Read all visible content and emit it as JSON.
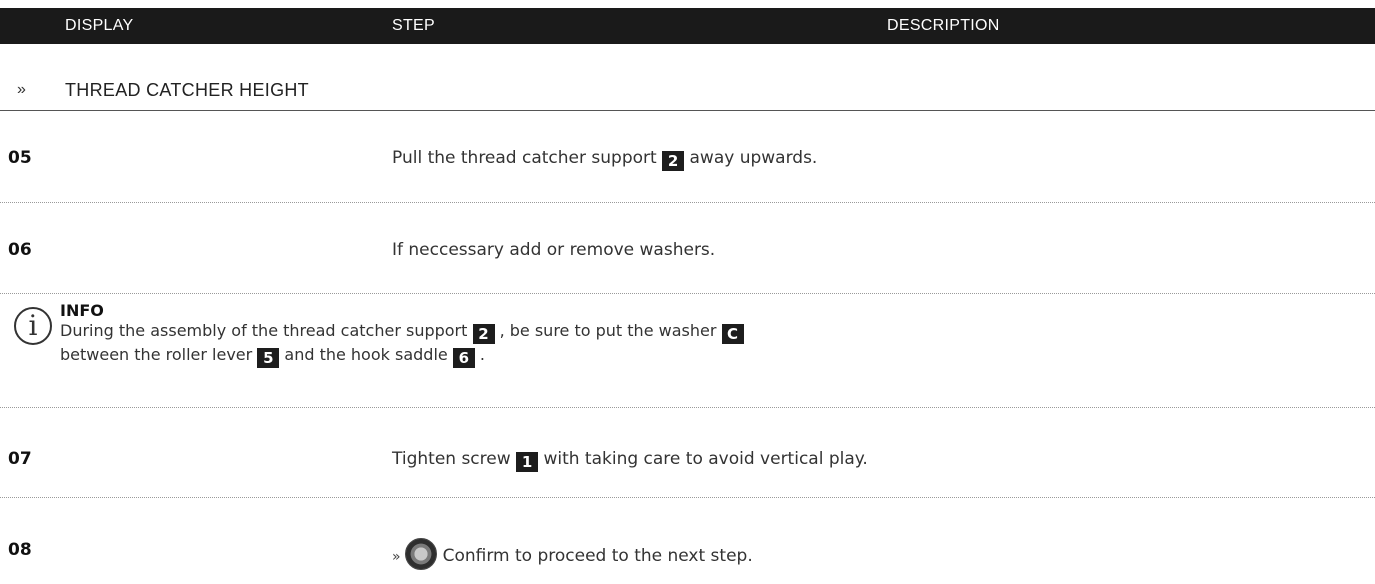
{
  "header": {
    "display": "DISPLAY",
    "step": "STEP",
    "description": "DESCRIPTION"
  },
  "section": {
    "arrow": "»",
    "title": "THREAD CATCHER HEIGHT"
  },
  "steps": [
    {
      "num": "05",
      "before": "Pull the thread catcher support ",
      "badge": "2",
      "after": " away upwards."
    },
    {
      "num": "06",
      "text": "If neccessary add or remove washers."
    },
    {
      "num": "07",
      "before": "Tighten screw ",
      "badge": "1",
      "after": " with taking care to avoid vertical play."
    },
    {
      "num": "08",
      "arrow": "»",
      "icon": "confirm-knob-icon",
      "text": "Confirm to proceed to the next step."
    }
  ],
  "info": {
    "icon_glyph": "i",
    "title": "INFO",
    "line1_a": "During the assembly of the thread catcher support ",
    "badge1": "2",
    "line1_b": " , be sure to put the washer ",
    "badge2": "C",
    "line2_a": "between the roller lever ",
    "badge3": "5",
    "line2_b": " and the hook saddle ",
    "badge4": "6",
    "line2_c": " ."
  },
  "colors": {
    "header_bg": "#1a1a1a",
    "badge_bg": "#1d1d1d"
  }
}
